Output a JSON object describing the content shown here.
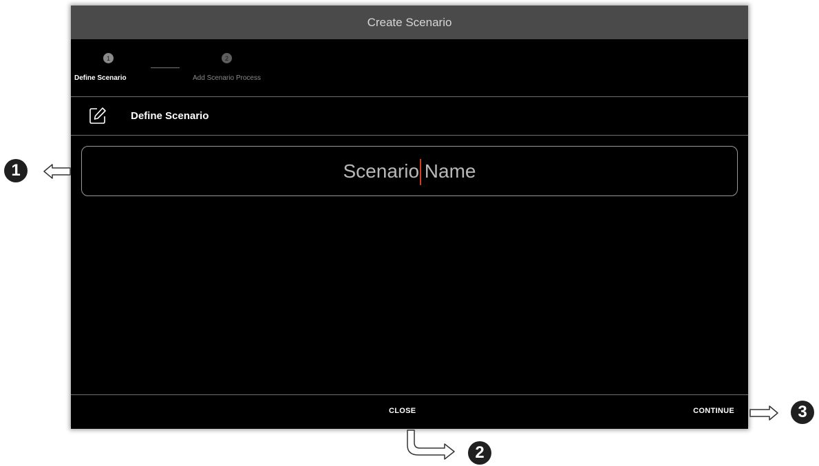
{
  "dialog": {
    "title": "Create Scenario"
  },
  "stepper": {
    "steps": [
      {
        "number": "1",
        "label": "Define Scenario"
      },
      {
        "number": "2",
        "label": "Add Scenario Process"
      }
    ]
  },
  "section": {
    "title": "Define Scenario",
    "icon": "edit-icon"
  },
  "form": {
    "scenario_name_placeholder": "Scenario Name",
    "scenario_name_value": ""
  },
  "footer": {
    "close_label": "CLOSE",
    "continue_label": "CONTINUE"
  },
  "annotations": {
    "badges": [
      "1",
      "2",
      "3"
    ]
  },
  "colors": {
    "titlebar": "#4a4a4a",
    "background": "#000000",
    "caret": "#d04020"
  }
}
